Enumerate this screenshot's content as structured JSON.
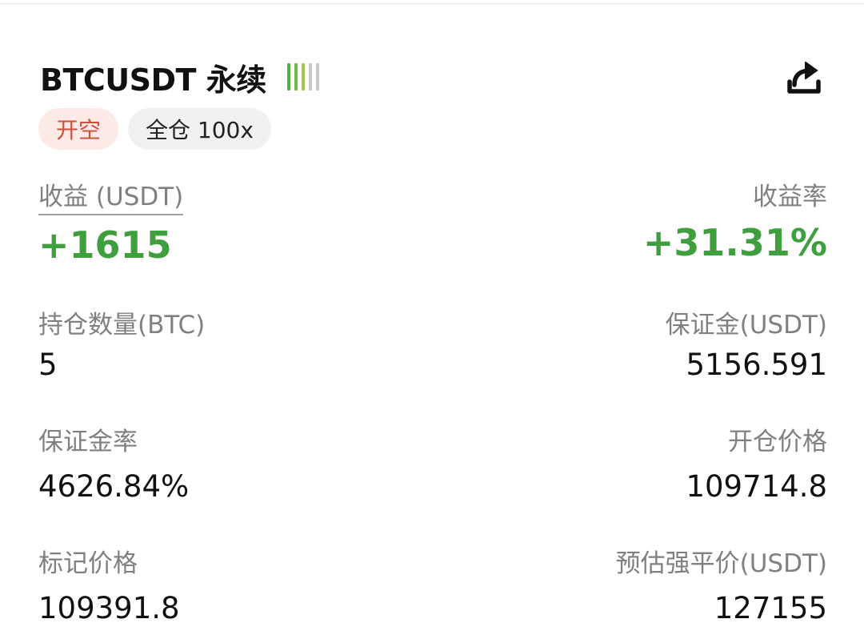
{
  "header": {
    "symbol_title": "BTCUSDT 永续",
    "strength_bar_colors": [
      "#56ad4b",
      "#6cba50",
      "#a2c84c",
      "#c8c8c8",
      "#c8c8c8"
    ],
    "share_icon": "share-icon"
  },
  "tags": {
    "side": "开空",
    "margin_mode": "全仓 100x"
  },
  "stats": {
    "pnl": {
      "label": "收益 (USDT)",
      "value": "+1615"
    },
    "roi": {
      "label": "收益率",
      "value": "+31.31%"
    },
    "position_size": {
      "label": "持仓数量(BTC)",
      "value": "5"
    },
    "margin": {
      "label": "保证金(USDT)",
      "value": "5156.591"
    },
    "margin_ratio": {
      "label": "保证金率",
      "value": "4626.84%"
    },
    "entry_price": {
      "label": "开仓价格",
      "value": "109714.8"
    },
    "mark_price": {
      "label": "标记价格",
      "value": "109391.8"
    },
    "liq_price": {
      "label": "预估强平价(USDT)",
      "value": "127155"
    }
  },
  "colors": {
    "profit_green": "#3f9f3f",
    "short_red": "#d04f3c",
    "short_tag_bg": "#fde9e6"
  }
}
